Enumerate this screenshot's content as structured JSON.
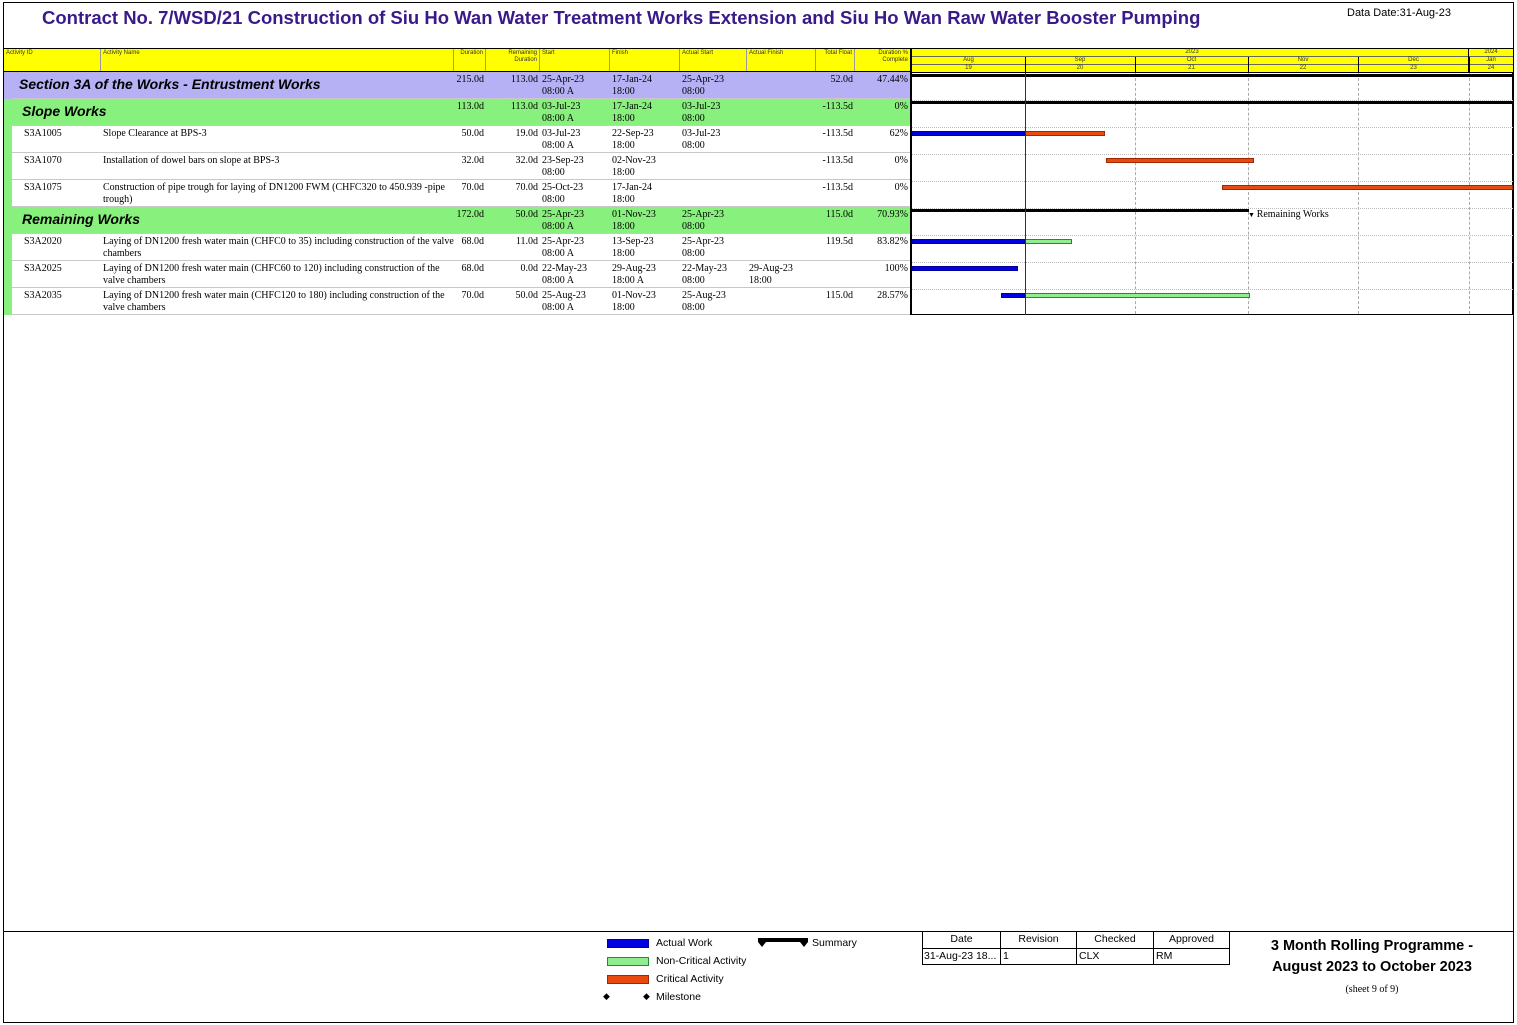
{
  "title": "Contract No. 7/WSD/21 Construction of Siu Ho Wan Water Treatment Works Extension and Siu Ho Wan Raw Water Booster Pumping",
  "data_date": "Data Date:31-Aug-23",
  "columns": {
    "activity_id": "Activity ID",
    "activity_name": "Activity Name",
    "duration": "Duration",
    "remaining_duration": "Remaining Duration",
    "start": "Start",
    "finish": "Finish",
    "actual_start": "Actual Start",
    "actual_finish": "Actual Finish",
    "total_float": "Total Float",
    "duration_pct": "Duration % Complete"
  },
  "timescale": {
    "year_2023": "2023",
    "year_2024": "2024",
    "months": [
      "Aug",
      "Sep",
      "Oct",
      "Nov",
      "Dec",
      "Jan"
    ],
    "month_codes": [
      "19",
      "20",
      "21",
      "22",
      "23",
      "24"
    ]
  },
  "rows": [
    {
      "type": "section",
      "name": "Section 3A of the Works - Entrustment Works",
      "duration": "215.0d",
      "remaining": "113.0d",
      "start1": "25-Apr-23",
      "start2": "08:00 A",
      "finish1": "17-Jan-24",
      "finish2": "18:00",
      "astart1": "25-Apr-23",
      "astart2": "08:00",
      "afinish1": "",
      "afinish2": "",
      "float": "52.0d",
      "pct": "47.44%"
    },
    {
      "type": "group",
      "name": "Slope Works",
      "duration": "113.0d",
      "remaining": "113.0d",
      "start1": "03-Jul-23",
      "start2": "08:00 A",
      "finish1": "17-Jan-24",
      "finish2": "18:00",
      "astart1": "03-Jul-23",
      "astart2": "08:00",
      "afinish1": "",
      "afinish2": "",
      "float": "-113.5d",
      "pct": "0%"
    },
    {
      "type": "activity",
      "id": "S3A1005",
      "name": "Slope Clearance at  BPS-3",
      "duration": "50.0d",
      "remaining": "19.0d",
      "start1": "03-Jul-23",
      "start2": "08:00 A",
      "finish1": "22-Sep-23",
      "finish2": "18:00",
      "astart1": "03-Jul-23",
      "astart2": "08:00",
      "afinish1": "",
      "afinish2": "",
      "float": "-113.5d",
      "pct": "62%"
    },
    {
      "type": "activity",
      "id": "S3A1070",
      "name": "Installation of dowel bars on slope at BPS-3",
      "duration": "32.0d",
      "remaining": "32.0d",
      "start1": "23-Sep-23",
      "start2": "08:00",
      "finish1": "02-Nov-23",
      "finish2": "18:00",
      "astart1": "",
      "astart2": "",
      "afinish1": "",
      "afinish2": "",
      "float": "-113.5d",
      "pct": "0%"
    },
    {
      "type": "activity",
      "id": "S3A1075",
      "name": "Construction of pipe trough for laying of DN1200 FWM (CHFC320 to 450.939 -pipe trough)",
      "duration": "70.0d",
      "remaining": "70.0d",
      "start1": "25-Oct-23",
      "start2": "08:00",
      "finish1": "17-Jan-24",
      "finish2": "18:00",
      "astart1": "",
      "astart2": "",
      "afinish1": "",
      "afinish2": "",
      "float": "-113.5d",
      "pct": "0%"
    },
    {
      "type": "group",
      "name": "Remaining Works",
      "duration": "172.0d",
      "remaining": "50.0d",
      "start1": "25-Apr-23",
      "start2": "08:00 A",
      "finish1": "01-Nov-23",
      "finish2": "18:00",
      "astart1": "25-Apr-23",
      "astart2": "08:00",
      "afinish1": "",
      "afinish2": "",
      "float": "115.0d",
      "pct": "70.93%"
    },
    {
      "type": "activity",
      "id": "S3A2020",
      "name": "Laying of DN1200 fresh water main (CHFC0 to 35) including construction of the valve chambers",
      "duration": "68.0d",
      "remaining": "11.0d",
      "start1": "25-Apr-23",
      "start2": "08:00 A",
      "finish1": "13-Sep-23",
      "finish2": "18:00",
      "astart1": "25-Apr-23",
      "astart2": "08:00",
      "afinish1": "",
      "afinish2": "",
      "float": "119.5d",
      "pct": "83.82%"
    },
    {
      "type": "activity",
      "id": "S3A2025",
      "name": "Laying of DN1200 fresh water main (CHFC60 to 120) including construction of the valve chambers",
      "duration": "68.0d",
      "remaining": "0.0d",
      "start1": "22-May-23",
      "start2": "08:00 A",
      "finish1": "29-Aug-23",
      "finish2": "18:00 A",
      "astart1": "22-May-23",
      "astart2": "08:00",
      "afinish1": "29-Aug-23",
      "afinish2": "18:00",
      "float": "",
      "pct": "100%"
    },
    {
      "type": "activity",
      "id": "S3A2035",
      "name": "Laying of DN1200 fresh water main (CHFC120 to 180) including construction of the valve chambers",
      "duration": "70.0d",
      "remaining": "50.0d",
      "start1": "25-Aug-23",
      "start2": "08:00 A",
      "finish1": "01-Nov-23",
      "finish2": "18:00",
      "astart1": "25-Aug-23",
      "astart2": "08:00",
      "afinish1": "",
      "afinish2": "",
      "float": "115.0d",
      "pct": "28.57%"
    }
  ],
  "gantt_labels": {
    "remaining_works": "Remaining Works"
  },
  "legend": {
    "actual_work": "Actual Work",
    "non_critical": "Non-Critical Activity",
    "critical": "Critical Activity",
    "milestone": "Milestone",
    "summary": "Summary"
  },
  "colors": {
    "title": "#3a1a8a",
    "header": "#ffff00",
    "section": "#b6b0f4",
    "group": "#88f07c",
    "actual": "#0000e0",
    "critical": "#e84a10",
    "non_critical": "#90ee90"
  },
  "revision": {
    "headers": [
      "Date",
      "Revision",
      "Checked",
      "Approved"
    ],
    "values": [
      "31-Aug-23 18...",
      "1",
      "CLX",
      "RM"
    ]
  },
  "programme": {
    "line1": "3 Month Rolling Programme -",
    "line2": "August 2023 to October 2023",
    "sheet": "(sheet 9 of 9)"
  }
}
